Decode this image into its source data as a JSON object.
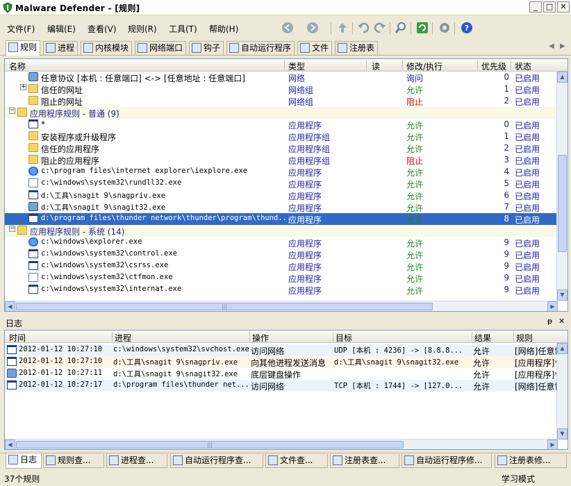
{
  "window": {
    "title": "Malware Defender - [规则]",
    "minimize": "_",
    "maximize": "□",
    "close": "✕"
  },
  "menu": [
    "文件(F)",
    "编辑(E)",
    "查看(V)",
    "规则(R)",
    "工具(T)",
    "帮助(H)"
  ],
  "toolbar": {
    "icons": [
      "back-icon",
      "forward-icon",
      "up-icon",
      "undo-icon",
      "redo-icon",
      "search-icon",
      "refresh-icon",
      "settings-icon",
      "help-icon"
    ]
  },
  "tabs": [
    {
      "label": "规则",
      "icon": "rules-icon",
      "active": true
    },
    {
      "label": "进程",
      "icon": "process-icon"
    },
    {
      "label": "内核模块",
      "icon": "kernel-module-icon"
    },
    {
      "label": "网络端口",
      "icon": "network-port-icon"
    },
    {
      "label": "钩子",
      "icon": "hook-icon"
    },
    {
      "label": "自动运行程序",
      "icon": "autorun-icon"
    },
    {
      "label": "文件",
      "icon": "file-icon"
    },
    {
      "label": "注册表",
      "icon": "registry-icon"
    }
  ],
  "tabnav": {
    "left": "◀",
    "right": "▶"
  },
  "rules_table": {
    "columns": {
      "name": "名称",
      "type": "类型",
      "read": "读",
      "modify": "修改/执行",
      "priority": "优先级",
      "state": "状态"
    },
    "rows": [
      {
        "kind": "item",
        "indent": 2,
        "icon": "network-icon",
        "name": "任意协议 [本机 : 任意端口] <-> [任意地址 : 任意端口]",
        "type": "网络",
        "action": "询问",
        "act": "ask",
        "prio": "0",
        "state": "已启用"
      },
      {
        "kind": "item",
        "indent": 2,
        "icon": "folder-icon",
        "expander": "+",
        "name": "信任的网址",
        "type": "网络组",
        "action": "允许",
        "act": "allow",
        "prio": "1",
        "state": "已启用"
      },
      {
        "kind": "item",
        "indent": 2,
        "icon": "folder-icon",
        "name": "阻止的网址",
        "type": "网络组",
        "action": "阻止",
        "act": "block",
        "prio": "2",
        "state": "已启用"
      },
      {
        "kind": "group",
        "indent": 0,
        "icon": "group-icon",
        "expander": "−",
        "name": "应用程序规则 - 普通 (9)"
      },
      {
        "kind": "item",
        "indent": 2,
        "icon": "app-window-icon",
        "name": "*",
        "type": "应用程序",
        "action": "允许",
        "act": "allow",
        "prio": "0",
        "state": "已启用"
      },
      {
        "kind": "item",
        "indent": 2,
        "icon": "folder-icon",
        "name": "安装程序或升级程序",
        "type": "应用程序组",
        "action": "允许",
        "act": "allow",
        "prio": "1",
        "state": "已启用"
      },
      {
        "kind": "item",
        "indent": 2,
        "icon": "folder-icon",
        "name": "信任的应用程序",
        "type": "应用程序组",
        "action": "允许",
        "act": "allow",
        "prio": "2",
        "state": "已启用"
      },
      {
        "kind": "item",
        "indent": 2,
        "icon": "folder-icon",
        "name": "阻止的应用程序",
        "type": "应用程序组",
        "action": "阻止",
        "act": "block",
        "prio": "3",
        "state": "已启用"
      },
      {
        "kind": "item",
        "indent": 2,
        "icon": "ie-icon",
        "name": "c:\\program files\\internet explorer\\iexplore.exe",
        "mono": true,
        "type": "应用程序",
        "action": "允许",
        "act": "allow",
        "prio": "4",
        "state": "已启用"
      },
      {
        "kind": "item",
        "indent": 2,
        "icon": "document-icon",
        "name": "c:\\windows\\system32\\rundll32.exe",
        "mono": true,
        "type": "应用程序",
        "action": "允许",
        "act": "allow",
        "prio": "5",
        "state": "已启用"
      },
      {
        "kind": "item",
        "indent": 2,
        "icon": "app-window-icon",
        "name": "d:\\工具\\snagit 9\\snagpriv.exe",
        "mono": true,
        "type": "应用程序",
        "action": "允许",
        "act": "allow",
        "prio": "6",
        "state": "已启用"
      },
      {
        "kind": "item",
        "indent": 2,
        "icon": "snagit-icon",
        "name": "d:\\工具\\snagit 9\\snagit32.exe",
        "mono": true,
        "type": "应用程序",
        "action": "允许",
        "act": "allow",
        "prio": "7",
        "state": "已启用"
      },
      {
        "kind": "item",
        "indent": 2,
        "icon": "app-window-icon",
        "name": "d:\\program files\\thunder network\\thunder\\program\\thund...",
        "mono": true,
        "type": "应用程序",
        "action": "允许",
        "act": "allow",
        "prio": "8",
        "state": "已启用",
        "selected": true
      },
      {
        "kind": "group",
        "indent": 0,
        "icon": "group-icon",
        "expander": "−",
        "name": "应用程序规则 - 系统 (14)"
      },
      {
        "kind": "item",
        "indent": 2,
        "icon": "explorer-icon",
        "name": "c:\\windows\\explorer.exe",
        "mono": true,
        "type": "应用程序",
        "action": "允许",
        "act": "allow",
        "prio": "9",
        "state": "已启用"
      },
      {
        "kind": "item",
        "indent": 2,
        "icon": "app-window-icon",
        "name": "c:\\windows\\system32\\control.exe",
        "mono": true,
        "type": "应用程序",
        "action": "允许",
        "act": "allow",
        "prio": "9",
        "state": "已启用"
      },
      {
        "kind": "item",
        "indent": 2,
        "icon": "app-window-icon",
        "name": "c:\\windows\\system32\\csrss.exe",
        "mono": true,
        "type": "应用程序",
        "action": "允许",
        "act": "allow",
        "prio": "9",
        "state": "已启用"
      },
      {
        "kind": "item",
        "indent": 2,
        "icon": "pencil-icon",
        "name": "c:\\windows\\system32\\ctfmon.exe",
        "mono": true,
        "type": "应用程序",
        "action": "允许",
        "act": "allow",
        "prio": "9",
        "state": "已启用"
      },
      {
        "kind": "item",
        "indent": 2,
        "icon": "app-window-icon",
        "name": "c:\\windows\\system32\\internat.exe",
        "mono": true,
        "type": "应用程序",
        "action": "允许",
        "act": "allow",
        "prio": "9",
        "state": "已启用"
      }
    ]
  },
  "log_panel": {
    "title": "日志",
    "pin": "ᵽ",
    "close": "✕",
    "columns": {
      "time": "时间",
      "process": "进程",
      "operation": "操作",
      "target": "目标",
      "result": "结果",
      "rule": "规则"
    },
    "rows": [
      {
        "icon": "app-window-icon",
        "time": "2012-01-12 10:27:10",
        "process": "c:\\windows\\system32\\svchost.exe",
        "operation": "访问网络",
        "target": "UDP [本机 : 4236] -> [8.8.8...",
        "result": "允许",
        "rule": "[网络]任意协议"
      },
      {
        "icon": "app-window-icon",
        "time": "2012-01-12 10:27:10",
        "process": "d:\\工具\\snagit 9\\snagpriv.exe",
        "operation": "向其他进程发送消息",
        "target": "d:\\工具\\snagit 9\\snagit32.exe",
        "result": "允许",
        "rule": "[应用程序]*"
      },
      {
        "icon": "snagit-icon",
        "time": "2012-01-12 10:27:11",
        "process": "d:\\工具\\snagit 9\\snagit32.exe",
        "operation": "底层键盘操作",
        "target": "",
        "result": "允许",
        "rule": "[应用程序]*"
      },
      {
        "icon": "app-window-icon",
        "time": "2012-01-12 10:27:17",
        "process": "d:\\program files\\thunder net...",
        "operation": "访问网络",
        "target": "TCP [本机 : 1744] -> [127.0...",
        "result": "允许",
        "rule": "[网络]任意协议"
      }
    ]
  },
  "bottom_tabs": [
    {
      "label": "日志",
      "icon": "log-icon",
      "active": true
    },
    {
      "label": "规则查...",
      "icon": "rules-view-icon"
    },
    {
      "label": "进程查...",
      "icon": "process-view-icon"
    },
    {
      "label": "自动运行程序查...",
      "icon": "autorun-view-icon"
    },
    {
      "label": "文件查...",
      "icon": "file-view-icon"
    },
    {
      "label": "注册表查...",
      "icon": "registry-view-icon"
    },
    {
      "label": "自动运行程序修...",
      "icon": "autorun-edit-icon"
    },
    {
      "label": "注册表修...",
      "icon": "registry-edit-icon"
    }
  ],
  "status": {
    "left": "37个规则",
    "right": "学习模式"
  },
  "scroll": {
    "up": "▲",
    "down": "▼",
    "left": "◀",
    "right": "▶",
    "grip": "|||"
  },
  "colors": {
    "allow": "#1a8a1a",
    "block": "#d01010",
    "selection": "#316ac5",
    "group_bg": "#faf9e6",
    "type_text": "#1f1fa0"
  }
}
